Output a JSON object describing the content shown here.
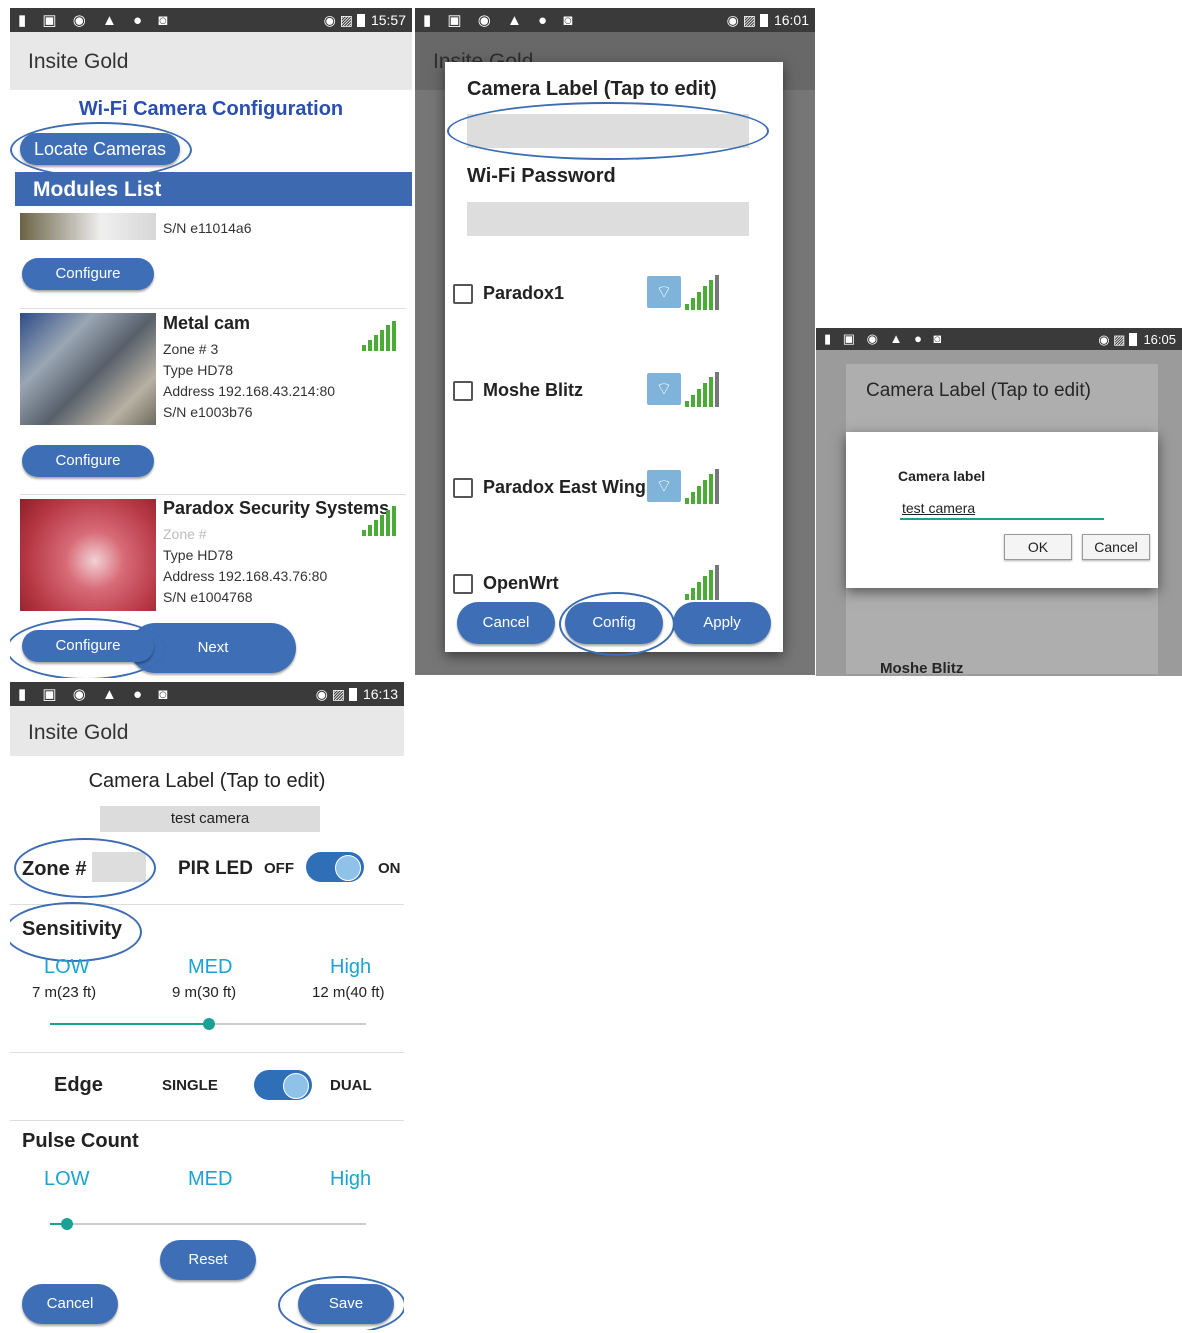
{
  "panel1": {
    "status": {
      "icons": "▮ ▣ ◉ ▲ ● ◙",
      "right_icons": "◉ ▨",
      "time": "15:57"
    },
    "app_title": "Insite Gold",
    "heading": "Wi-Fi Camera Configuration",
    "locate_label": "Locate Cameras",
    "modules_label": "Modules List",
    "cameras": [
      {
        "title": "",
        "lines": [
          "S/N e11014a6"
        ],
        "configure": "Configure"
      },
      {
        "title": "Metal cam",
        "lines": [
          "Zone # 3",
          "Type HD78",
          "Address 192.168.43.214:80",
          "S/N e1003b76"
        ],
        "configure": "Configure"
      },
      {
        "title": "Paradox Security Systems",
        "lines": [
          "Zone #",
          "Type HD78",
          "Address 192.168.43.76:80",
          "S/N e1004768"
        ],
        "configure": "Configure"
      }
    ],
    "next_label": "Next"
  },
  "panel2": {
    "status": {
      "icons": "▮ ▣ ◉ ▲ ● ◙",
      "right_icons": "◉ ▨",
      "time": "16:01"
    },
    "bg_title": "Insite Gold",
    "label_title": "Camera Label (Tap to edit)",
    "password_title": "Wi-Fi Password",
    "networks": [
      "Paradox1",
      "Moshe Blitz",
      "Paradox East Wing",
      "OpenWrt"
    ],
    "cancel": "Cancel",
    "config": "Config",
    "apply": "Apply",
    "colors": {
      "accent": "#3e6fb6",
      "signal": "#4aab36"
    }
  },
  "panel3": {
    "status": {
      "icons": "▮ ▣ ◉ ▲ ● ◙",
      "right_icons": "◉ ▨",
      "time": "16:05"
    },
    "bg_title": "Camera Label (Tap to edit)",
    "dialog_title": "Camera label",
    "input_value": "test camera",
    "ok": "OK",
    "cancel": "Cancel",
    "bg_network": "Moshe Blitz"
  },
  "panel4": {
    "status": {
      "icons": "▮ ▣ ◉ ▲ ● ◙",
      "right_icons": "◉ ▨",
      "time": "16:13"
    },
    "app_title": "Insite Gold",
    "label_title": "Camera Label (Tap to edit)",
    "label_value": "test camera",
    "zone_label": "Zone #",
    "pir_label": "PIR LED",
    "off": "OFF",
    "on": "ON",
    "sensitivity": "Sensitivity",
    "sens_levels": [
      {
        "name": "LOW",
        "dist": "7 m(23 ft)"
      },
      {
        "name": "MED",
        "dist": "9 m(30 ft)"
      },
      {
        "name": "High",
        "dist": "12 m(40 ft)"
      }
    ],
    "sensitivity_level": "MED",
    "edge": "Edge",
    "single": "SINGLE",
    "dual": "DUAL",
    "pulse_count": "Pulse Count",
    "pulse_levels": [
      "LOW",
      "MED",
      "High"
    ],
    "pulse_level": "LOW",
    "reset": "Reset",
    "cancel": "Cancel",
    "save": "Save"
  }
}
